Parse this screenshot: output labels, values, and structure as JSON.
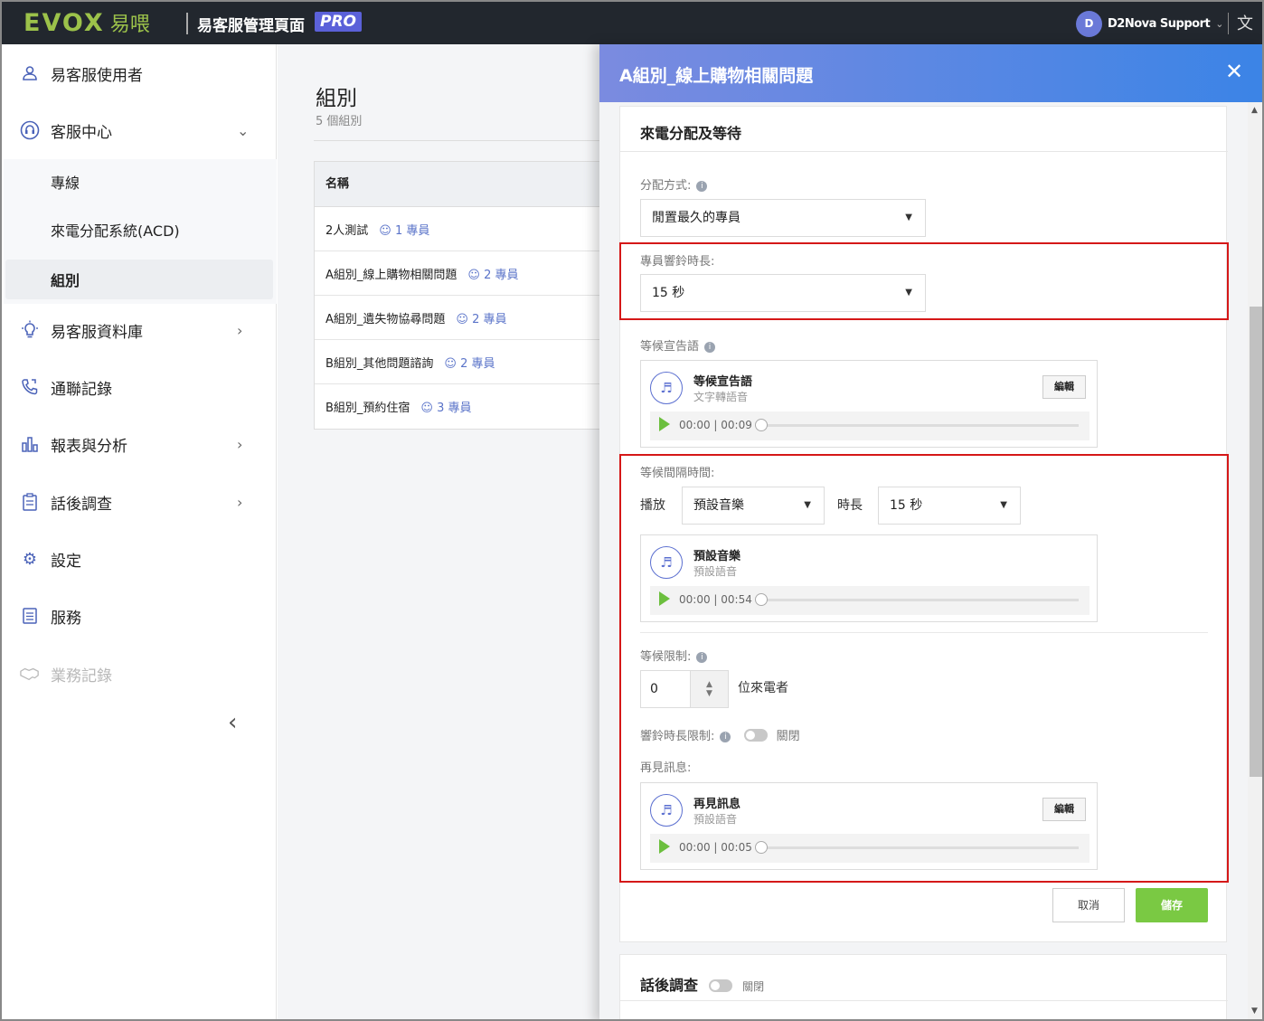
{
  "topbar": {
    "logo_text": "EVOX",
    "logo_cn": "易喂",
    "app_title": "易客服管理頁面",
    "pro_badge": "PRO",
    "user_initial": "D",
    "user_name": "D2Nova Support",
    "lang_icon": "translate-icon"
  },
  "sidebar": {
    "items": [
      {
        "label": "易客服使用者",
        "icon": "user-icon"
      },
      {
        "label": "客服中心",
        "icon": "headset-icon"
      },
      {
        "label": "易客服資料庫",
        "icon": "lightbulb-icon"
      },
      {
        "label": "通聯記錄",
        "icon": "phone-log-icon"
      },
      {
        "label": "報表與分析",
        "icon": "bar-chart-icon"
      },
      {
        "label": "話後調查",
        "icon": "survey-icon"
      },
      {
        "label": "設定",
        "icon": "gear-icon"
      },
      {
        "label": "服務",
        "icon": "list-icon"
      },
      {
        "label": "業務記錄",
        "icon": "handshake-icon"
      }
    ],
    "sub_items": [
      {
        "label": "專線"
      },
      {
        "label": "來電分配系統(ACD)"
      },
      {
        "label": "組別"
      }
    ]
  },
  "main": {
    "title": "組別",
    "subtitle": "5 個組別",
    "table": {
      "header": "名稱",
      "rows": [
        {
          "name": "2人測試",
          "count": "1 專員"
        },
        {
          "name": "A組別_線上購物相關問題",
          "count": "2 專員"
        },
        {
          "name": "A組別_遺失物協尋問題",
          "count": "2 專員"
        },
        {
          "name": "B組別_其他問題諮詢",
          "count": "2 專員"
        },
        {
          "name": "B組別_預約住宿",
          "count": "3 專員"
        }
      ]
    }
  },
  "drawer": {
    "title": "A組別_線上購物相關問題",
    "section1_title": "來電分配及等待",
    "dist_label": "分配方式:",
    "dist_value": "閒置最久的專員",
    "ring_label": "專員響鈴時長:",
    "ring_value": "15 秒",
    "announce_label": "等候宣告語",
    "announce_audio": {
      "title": "等候宣告語",
      "sub": "文字轉語音",
      "edit": "編輯",
      "time": "00:00 | 00:09"
    },
    "interval_label": "等候間隔時間:",
    "play_label": "播放",
    "play_value": "預設音樂",
    "duration_label": "時長",
    "duration_value": "15 秒",
    "music_audio": {
      "title": "預設音樂",
      "sub": "預設語音",
      "time": "00:00 | 00:54"
    },
    "limit_label": "等候限制:",
    "limit_value": "0",
    "limit_unit": "位來電者",
    "ring_limit_label": "響鈴時長限制:",
    "ring_limit_state": "關閉",
    "bye_label": "再見訊息:",
    "bye_audio": {
      "title": "再見訊息",
      "sub": "預設語音",
      "edit": "編輯",
      "time": "00:00 | 00:05"
    },
    "cancel": "取消",
    "save": "儲存",
    "section2_title": "話後調查",
    "section2_state": "關閉"
  },
  "colors": {
    "accent": "#4a62b8",
    "save_green": "#7ac943",
    "highlight_red": "#d51818",
    "header_gradient_start": "#7b8be0",
    "header_gradient_end": "#3b84e6"
  }
}
